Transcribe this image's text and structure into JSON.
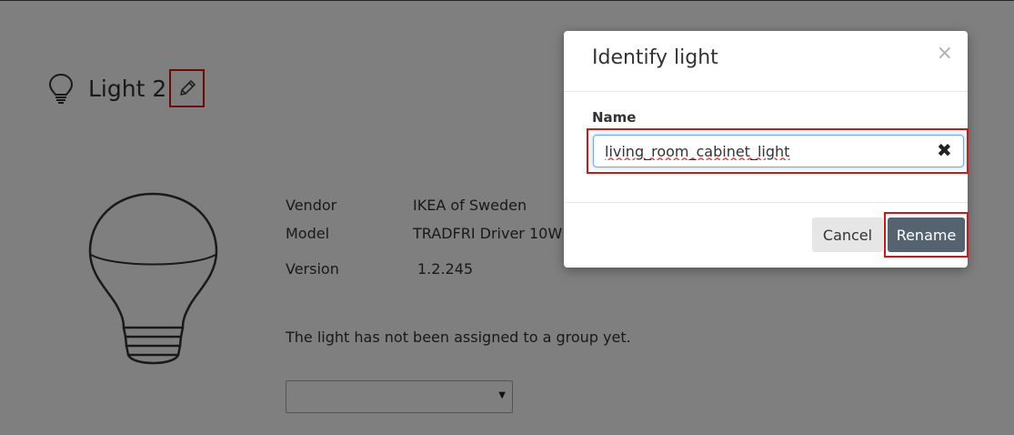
{
  "device": {
    "title": "Light 2",
    "icons": {
      "device": "lightbulb-icon",
      "edit": "pencil-icon"
    }
  },
  "details": {
    "vendor_label": "Vendor",
    "vendor_value": "IKEA of Sweden",
    "model_label": "Model",
    "model_value": "TRADFRI Driver 10W",
    "version_label": "Version",
    "version_value": "1.2.245"
  },
  "group": {
    "notice": "The light has not been assigned to a group yet.",
    "selected": ""
  },
  "modal": {
    "title": "Identify light",
    "close_symbol": "×",
    "field_label": "Name",
    "name_value": "living_room_cabinet_light",
    "clear_symbol": "✖",
    "cancel_label": "Cancel",
    "rename_label": "Rename"
  },
  "colors": {
    "highlight": "#e01010",
    "primary_button": "#556270",
    "secondary_button": "#e6e6e6",
    "focus_border": "#66afe9"
  }
}
